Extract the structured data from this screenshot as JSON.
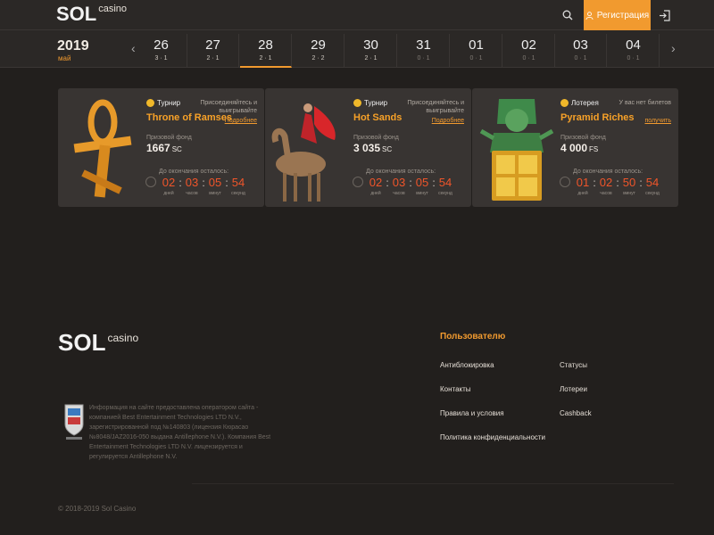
{
  "header": {
    "logo_text": "SOL",
    "logo_sub": "casino",
    "register_label": "Регистрация"
  },
  "calendar": {
    "year": "2019",
    "month": "май",
    "prev_arrow": "‹",
    "next_arrow": "›",
    "days": [
      {
        "num": "26",
        "counts": "3 · 1"
      },
      {
        "num": "27",
        "counts": "2 · 1"
      },
      {
        "num": "28",
        "counts": "2 · 1"
      },
      {
        "num": "29",
        "counts": "2 · 2"
      },
      {
        "num": "30",
        "counts": "2 · 1"
      },
      {
        "num": "31",
        "counts": "0 · 1"
      },
      {
        "num": "01",
        "counts": "0 · 1"
      },
      {
        "num": "02",
        "counts": "0 · 1"
      },
      {
        "num": "03",
        "counts": "0 · 1"
      },
      {
        "num": "04",
        "counts": "0 · 1"
      }
    ]
  },
  "cards": [
    {
      "type": "Турнир",
      "note": "Присоединяйтесь и выигрывайте",
      "link": "Подробнее",
      "title": "Throne of Ramses",
      "fund_label": "Призовой фонд",
      "fund_value": "1667",
      "fund_unit": "SC",
      "left_label": "До окончания осталось:",
      "timer": {
        "days": "02",
        "hours": "03",
        "minutes": "05",
        "seconds": "54"
      }
    },
    {
      "type": "Турнир",
      "note": "Присоединяйтесь и выигрывайте",
      "link": "Подробнее",
      "title": "Hot Sands",
      "fund_label": "Призовой фонд",
      "fund_value": "3 035",
      "fund_unit": "SC",
      "left_label": "До окончания осталось:",
      "timer": {
        "days": "02",
        "hours": "03",
        "minutes": "05",
        "seconds": "54"
      }
    },
    {
      "type": "Лотерея",
      "note": "У вас нет билетов",
      "link": "получить",
      "title": "Pyramid Riches",
      "fund_label": "Призовой фонд",
      "fund_value": "4 000",
      "fund_unit": "FS",
      "left_label": "До окончания осталось:",
      "timer": {
        "days": "01",
        "hours": "02",
        "minutes": "50",
        "seconds": "54"
      }
    }
  ],
  "timer_units": {
    "days": "дней",
    "hours": "часов",
    "minutes": "минут",
    "seconds": "секунд"
  },
  "footer": {
    "logo_text": "SOL",
    "logo_sub": "casino",
    "info": "Информация на сайте предоставлена оператором сайта - компанией Best Entertainment Technologies LTD N.V., зарегистрированной под №140803 (лицензия Кюрасао №8048/JAZ2016-050 выдана Antillephone N.V.). Компания Best Entertainment Technologies LTD N.V. лицензируется и регулируется Antillephone N.V.",
    "users_title": "Пользователю",
    "links_col1": [
      "Антиблокировка",
      "Контакты",
      "Правила и условия",
      "Политика конфиденциальности"
    ],
    "links_col2": [
      "Статусы",
      "Лотереи",
      "Cashback"
    ],
    "copyright": "© 2018-2019 Sol Casino"
  },
  "colors": {
    "accent": "#f19a2f",
    "timer": "#f0552a",
    "background": "#221f1d",
    "card": "#383432"
  }
}
